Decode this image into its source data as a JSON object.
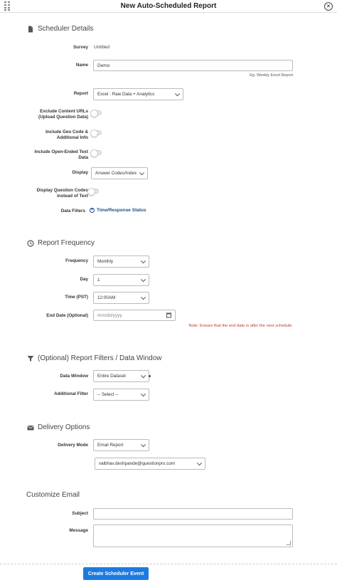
{
  "modal": {
    "title": "New Auto-Scheduled Report"
  },
  "scheduler": {
    "heading": "Scheduler Details",
    "survey_label": "Survey",
    "survey_value": "Untitled",
    "name_label": "Name",
    "name_value": "Demo",
    "name_hint": "Eg. Weekly Excel Report",
    "report_label": "Report",
    "report_value": "Excel : Raw Data + Analytics",
    "exclude_label_1": "Exclude Content URLs",
    "exclude_label_2": "(Upload Question Data)",
    "geo_label_1": "Include Geo Code &",
    "geo_label_2": "Additional Info",
    "open_label_1": "Include Open-Ended Text",
    "open_label_2": "Data",
    "display_label": "Display",
    "display_value": "Answer Codes/Index",
    "dq_label_1": "Display Question Codes",
    "dq_label_2": "instead of Text",
    "filters_label": "Data Filters",
    "filters_link": "Time/Response Status"
  },
  "frequency": {
    "heading": "Report Frequency",
    "frequency_label": "Frequency",
    "frequency_value": "Monthly",
    "day_label": "Day",
    "day_value": "1",
    "time_label": "Time (PST)",
    "time_value": "12:00AM",
    "end_label": "End Date (Optional)",
    "end_placeholder": "mm/dd/yyyy",
    "end_note": "Note: Ensure that the end date is after the next schedule."
  },
  "filters": {
    "heading": "(Optional) Report Filters / Data Window",
    "window_label": "Data Window",
    "window_value": "Entire Dataset",
    "additional_label": "Additional Filter",
    "additional_value": "-- Select --"
  },
  "delivery": {
    "heading": "Delivery Options",
    "mode_label": "Delivery Mode",
    "mode_value": "Email Report",
    "email_value": "vaibhav.deshpande@questionpro.com"
  },
  "email": {
    "heading": "Customize Email",
    "subject_label": "Subject",
    "message_label": "Message"
  },
  "actions": {
    "create_label": "Create Scheduler Event"
  },
  "colors": {
    "primary": "#1d7be0",
    "link": "#1a4f8b",
    "note": "#c0392b"
  }
}
